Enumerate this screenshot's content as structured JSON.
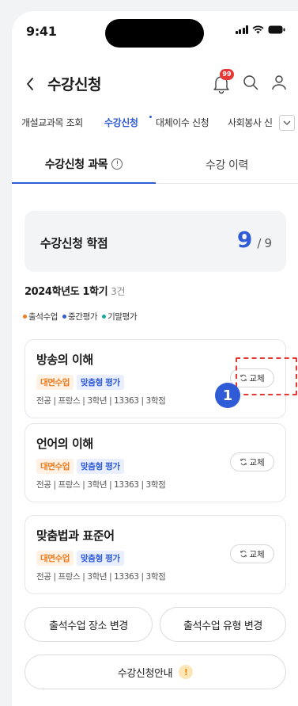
{
  "status_bar": {
    "time": "9:41"
  },
  "header": {
    "title": "수강신청",
    "notification_count": "99"
  },
  "subnav": {
    "items": [
      "개설교과목 조회",
      "수강신청",
      "대체이수 신청",
      "사회봉사 신"
    ]
  },
  "tabs": [
    {
      "label": "수강신청 과목",
      "info": "!"
    },
    {
      "label": "수강 이력"
    }
  ],
  "credits": {
    "label": "수강신청 학점",
    "current": "9",
    "separator": "/",
    "total": "9"
  },
  "semester": {
    "label": "2024학년도 1학기",
    "count": "3건"
  },
  "legend": [
    {
      "label": "출석수업",
      "color": "#ef7b1e"
    },
    {
      "label": "중간평가",
      "color": "#2f5bd6"
    },
    {
      "label": "기말평가",
      "color": "#18a5a5"
    }
  ],
  "courses": [
    {
      "name": "방송의 이해",
      "tag1": "대면수업",
      "tag2": "맞춤형 평가",
      "meta": "전공 | 프랑스 | 3학년 | 13363 | 3학점",
      "action": "교체"
    },
    {
      "name": "언어의 이해",
      "tag1": "대면수업",
      "tag2": "맞춤형 평가",
      "meta": "전공 | 프랑스 | 3학년 | 13363 | 3학점",
      "action": "교체"
    },
    {
      "name": "맞춤법과 표준어",
      "tag1": "대면수업",
      "tag2": "맞춤형 평가",
      "meta": "전공 | 프랑스 | 3학년 | 13363 | 3학점",
      "action": "교체"
    }
  ],
  "annotation": {
    "marker": "1"
  },
  "buttons": {
    "change_location": "출석수업 장소 변경",
    "change_type": "출석수업 유형 변경",
    "guide": "수강신청안내",
    "guide_icon": "!"
  },
  "colors": {
    "accent": "#2f5bd6",
    "orange": "#ef7b1e",
    "alert": "#e53935"
  }
}
